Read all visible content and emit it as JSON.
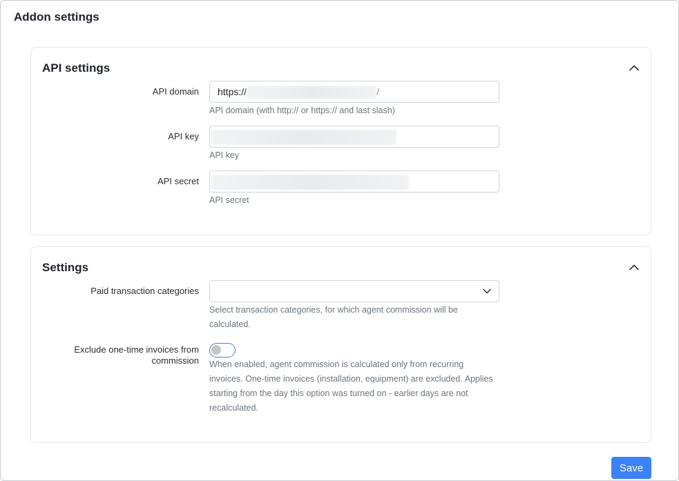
{
  "page": {
    "title": "Addon settings"
  },
  "api_settings": {
    "title": "API settings",
    "collapse_icon": "chevron-up-icon",
    "domain": {
      "label": "API domain",
      "value_prefix": "https://",
      "value_suffix": "/",
      "help": "API domain (with http:// or https:// and last slash)"
    },
    "key": {
      "label": "API key",
      "help": "API key"
    },
    "secret": {
      "label": "API secret",
      "help": "API secret"
    }
  },
  "settings": {
    "title": "Settings",
    "collapse_icon": "chevron-up-icon",
    "paid_categories": {
      "label": "Paid transaction categories",
      "value": "",
      "help": "Select transaction categories, for which agent commission will be calculated.",
      "dropdown_icon": "chevron-down-icon"
    },
    "exclude_one_time": {
      "label": "Exclude one-time invoices from commission",
      "enabled": false,
      "help": "When enabled, agent commission is calculated only from recurring invoices. One-time invoices (installation, equipment) are excluded. Applies starting from the day this option was turned on - earlier days are not recalculated."
    }
  },
  "actions": {
    "save_label": "Save"
  },
  "colors": {
    "primary": "#3b82f6",
    "toggle_border": "#4a7fd6",
    "help_text": "#6c757d",
    "border": "#e3e6ea"
  }
}
